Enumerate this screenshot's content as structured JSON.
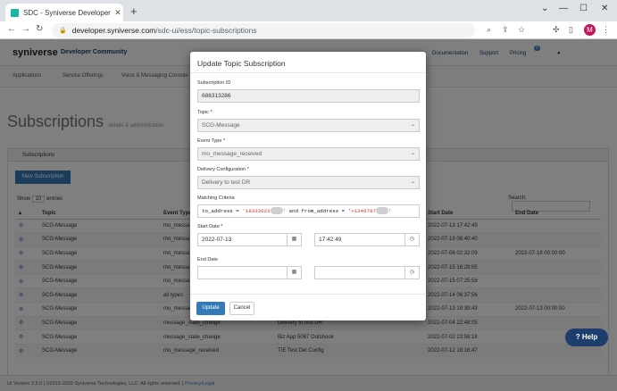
{
  "browser": {
    "tab_title": "SDC - Syniverse Developer Comm",
    "url_host": "developer.syniverse.com",
    "url_path": "/sdc-ui/ess/topic-subscriptions",
    "avatar_initial": "M"
  },
  "site": {
    "logo": "syniverse",
    "brand": "Developer Community",
    "nav": [
      "Documentation",
      "Support",
      "Pricing"
    ],
    "notification_count": "0",
    "subnav": [
      "Applications",
      "Service Offerings",
      "Voice & Messaging Console"
    ]
  },
  "page": {
    "title": "Subscriptions",
    "subtitle": "details & administration",
    "panel_title": "Subscriptions",
    "new_button": "New Subscription",
    "show_label": "Show",
    "show_value": "10",
    "entries_label": "entries",
    "search_label": "Search:",
    "columns": [
      "",
      "Topic",
      "Event Type",
      "",
      "Start Date",
      "End Date"
    ],
    "rows": [
      {
        "topic": "SCG-Message",
        "event": "mo_messa",
        "desc": "",
        "start": "2022-07-13 17:42:49",
        "end": ""
      },
      {
        "topic": "SCG-Message",
        "event": "mo_messa",
        "desc": "",
        "start": "2022-07-19 06:40:40",
        "end": ""
      },
      {
        "topic": "SCG-Message",
        "event": "mo_messa",
        "desc": "",
        "start": "2022-07-06 02:32:09",
        "end": "2022-07-18 00:00:00"
      },
      {
        "topic": "SCG-Message",
        "event": "mo_messa",
        "desc": "",
        "start": "2022-07-15 16:29:05",
        "end": ""
      },
      {
        "topic": "SCG-Message",
        "event": "mo_messa",
        "desc": "",
        "start": "2022-07-15 07:25:59",
        "end": ""
      },
      {
        "topic": "SCG-Message",
        "event": "all types",
        "desc": "",
        "start": "2022-07-14 06:37:56",
        "end": ""
      },
      {
        "topic": "SCG-Message",
        "event": "mo_message_received",
        "desc": "WhatsApp Kore Demo",
        "start": "2022-07-13 19:39:43",
        "end": "2022-07-13 00:00:00"
      },
      {
        "topic": "SCG-Message",
        "event": "message_state_change",
        "desc": "Delivery to test DR",
        "start": "2022-07-04 22:48:05",
        "end": ""
      },
      {
        "topic": "SCG-Message",
        "event": "message_state_change",
        "desc": "Biz App 5067 Outshook",
        "start": "2022-07-02 23:56:18",
        "end": ""
      },
      {
        "topic": "SCG-Message",
        "event": "mo_message_received",
        "desc": "TIE Test Del Config",
        "start": "2022-07-12 18:16:47",
        "end": ""
      }
    ],
    "footer_text": "UI Version 2.5.0 | ©2015-2022 Syniverse Technologies, LLC. All rights reserved. |",
    "footer_link": "Privacy/Legal",
    "help": "Help"
  },
  "modal": {
    "title": "Update Topic Subscription",
    "subscription_id_label": "Subscription ID",
    "subscription_id": "686313286",
    "topic_label": "Topic",
    "topic_value": "SCG-Message",
    "event_type_label": "Event Type",
    "event_type_value": "mo_message_received",
    "delivery_label": "Delivery Configuration",
    "delivery_value": "Delivery to test DR",
    "criteria_label": "Matching Criteria",
    "criteria_prefix": "to_address = ",
    "criteria_to": "'18333622",
    "criteria_mid": " and from_address = ",
    "criteria_from": "'+1346787",
    "criteria_end": "'",
    "start_label": "Start Date",
    "start_date": "2022-07-13",
    "start_time": "17:42:49",
    "end_label": "End Date",
    "end_date": "",
    "end_time": "",
    "update_button": "Update",
    "cancel_button": "Cancel",
    "required_mark": "*"
  }
}
